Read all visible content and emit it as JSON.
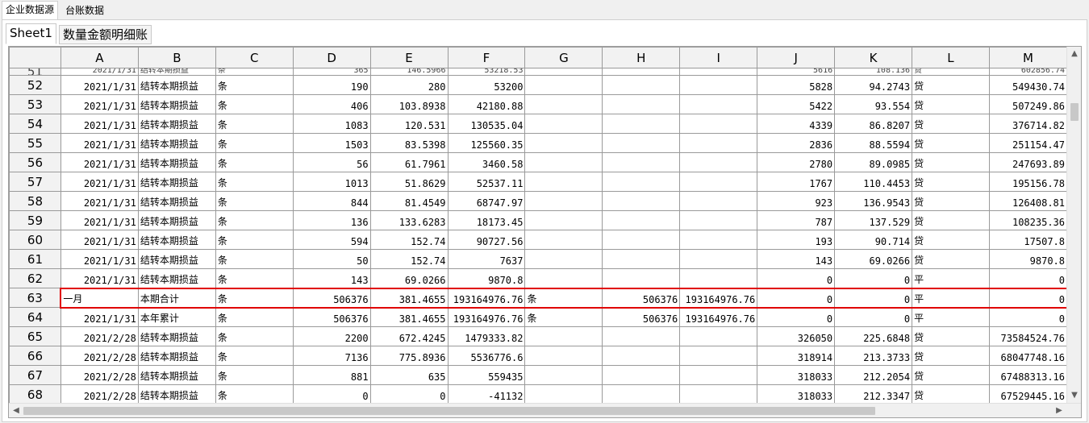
{
  "top_tabs": [
    {
      "label": "企业数据源",
      "active": true
    },
    {
      "label": "台账数据",
      "active": false
    }
  ],
  "sheet_tabs": [
    {
      "label": "Sheet1",
      "active": true
    },
    {
      "label": "数量金额明细账",
      "active": false
    }
  ],
  "columns": [
    "A",
    "B",
    "C",
    "D",
    "E",
    "F",
    "G",
    "H",
    "I",
    "J",
    "K",
    "L",
    "M"
  ],
  "partial_row": {
    "num": "51",
    "cells": [
      "2021/1/31",
      "结转本期损益",
      "条",
      "365",
      "146.5966",
      "53218.53",
      "",
      "",
      "",
      "5616",
      "108.136",
      "贷",
      "602856.74"
    ]
  },
  "rows": [
    {
      "num": "52",
      "cells": [
        "2021/1/31",
        "结转本期损益",
        "条",
        "190",
        "280",
        "53200",
        "",
        "",
        "",
        "5828",
        "94.2743",
        "贷",
        "549430.74"
      ]
    },
    {
      "num": "53",
      "cells": [
        "2021/1/31",
        "结转本期损益",
        "条",
        "406",
        "103.8938",
        "42180.88",
        "",
        "",
        "",
        "5422",
        "93.554",
        "贷",
        "507249.86"
      ]
    },
    {
      "num": "54",
      "cells": [
        "2021/1/31",
        "结转本期损益",
        "条",
        "1083",
        "120.531",
        "130535.04",
        "",
        "",
        "",
        "4339",
        "86.8207",
        "贷",
        "376714.82"
      ]
    },
    {
      "num": "55",
      "cells": [
        "2021/1/31",
        "结转本期损益",
        "条",
        "1503",
        "83.5398",
        "125560.35",
        "",
        "",
        "",
        "2836",
        "88.5594",
        "贷",
        "251154.47"
      ]
    },
    {
      "num": "56",
      "cells": [
        "2021/1/31",
        "结转本期损益",
        "条",
        "56",
        "61.7961",
        "3460.58",
        "",
        "",
        "",
        "2780",
        "89.0985",
        "贷",
        "247693.89"
      ]
    },
    {
      "num": "57",
      "cells": [
        "2021/1/31",
        "结转本期损益",
        "条",
        "1013",
        "51.8629",
        "52537.11",
        "",
        "",
        "",
        "1767",
        "110.4453",
        "贷",
        "195156.78"
      ]
    },
    {
      "num": "58",
      "cells": [
        "2021/1/31",
        "结转本期损益",
        "条",
        "844",
        "81.4549",
        "68747.97",
        "",
        "",
        "",
        "923",
        "136.9543",
        "贷",
        "126408.81"
      ]
    },
    {
      "num": "59",
      "cells": [
        "2021/1/31",
        "结转本期损益",
        "条",
        "136",
        "133.6283",
        "18173.45",
        "",
        "",
        "",
        "787",
        "137.529",
        "贷",
        "108235.36"
      ]
    },
    {
      "num": "60",
      "cells": [
        "2021/1/31",
        "结转本期损益",
        "条",
        "594",
        "152.74",
        "90727.56",
        "",
        "",
        "",
        "193",
        "90.714",
        "贷",
        "17507.8"
      ]
    },
    {
      "num": "61",
      "cells": [
        "2021/1/31",
        "结转本期损益",
        "条",
        "50",
        "152.74",
        "7637",
        "",
        "",
        "",
        "143",
        "69.0266",
        "贷",
        "9870.8"
      ]
    },
    {
      "num": "62",
      "cells": [
        "2021/1/31",
        "结转本期损益",
        "条",
        "143",
        "69.0266",
        "9870.8",
        "",
        "",
        "",
        "0",
        "0",
        "平",
        "0"
      ]
    },
    {
      "num": "63",
      "selected": true,
      "cells": [
        "一月",
        "本期合计",
        "条",
        "506376",
        "381.4655",
        "193164976.76",
        "条",
        "506376",
        "193164976.76",
        "0",
        "0",
        "平",
        "0"
      ]
    },
    {
      "num": "64",
      "cells": [
        "2021/1/31",
        "本年累计",
        "条",
        "506376",
        "381.4655",
        "193164976.76",
        "条",
        "506376",
        "193164976.76",
        "0",
        "0",
        "平",
        "0"
      ]
    },
    {
      "num": "65",
      "cells": [
        "2021/2/28",
        "结转本期损益",
        "条",
        "2200",
        "672.4245",
        "1479333.82",
        "",
        "",
        "",
        "326050",
        "225.6848",
        "贷",
        "73584524.76"
      ]
    },
    {
      "num": "66",
      "cells": [
        "2021/2/28",
        "结转本期损益",
        "条",
        "7136",
        "775.8936",
        "5536776.6",
        "",
        "",
        "",
        "318914",
        "213.3733",
        "贷",
        "68047748.16"
      ]
    },
    {
      "num": "67",
      "cells": [
        "2021/2/28",
        "结转本期损益",
        "条",
        "881",
        "635",
        "559435",
        "",
        "",
        "",
        "318033",
        "212.2054",
        "贷",
        "67488313.16"
      ]
    },
    {
      "num": "68",
      "cells": [
        "2021/2/28",
        "结转本期损益",
        "条",
        "0",
        "0",
        "-41132",
        "",
        "",
        "",
        "318033",
        "212.3347",
        "贷",
        "67529445.16"
      ]
    }
  ],
  "icons": {
    "scroll_up": "chevron-up-icon",
    "scroll_down": "chevron-down-icon",
    "scroll_left": "chevron-left-icon",
    "scroll_right": "chevron-right-icon"
  }
}
